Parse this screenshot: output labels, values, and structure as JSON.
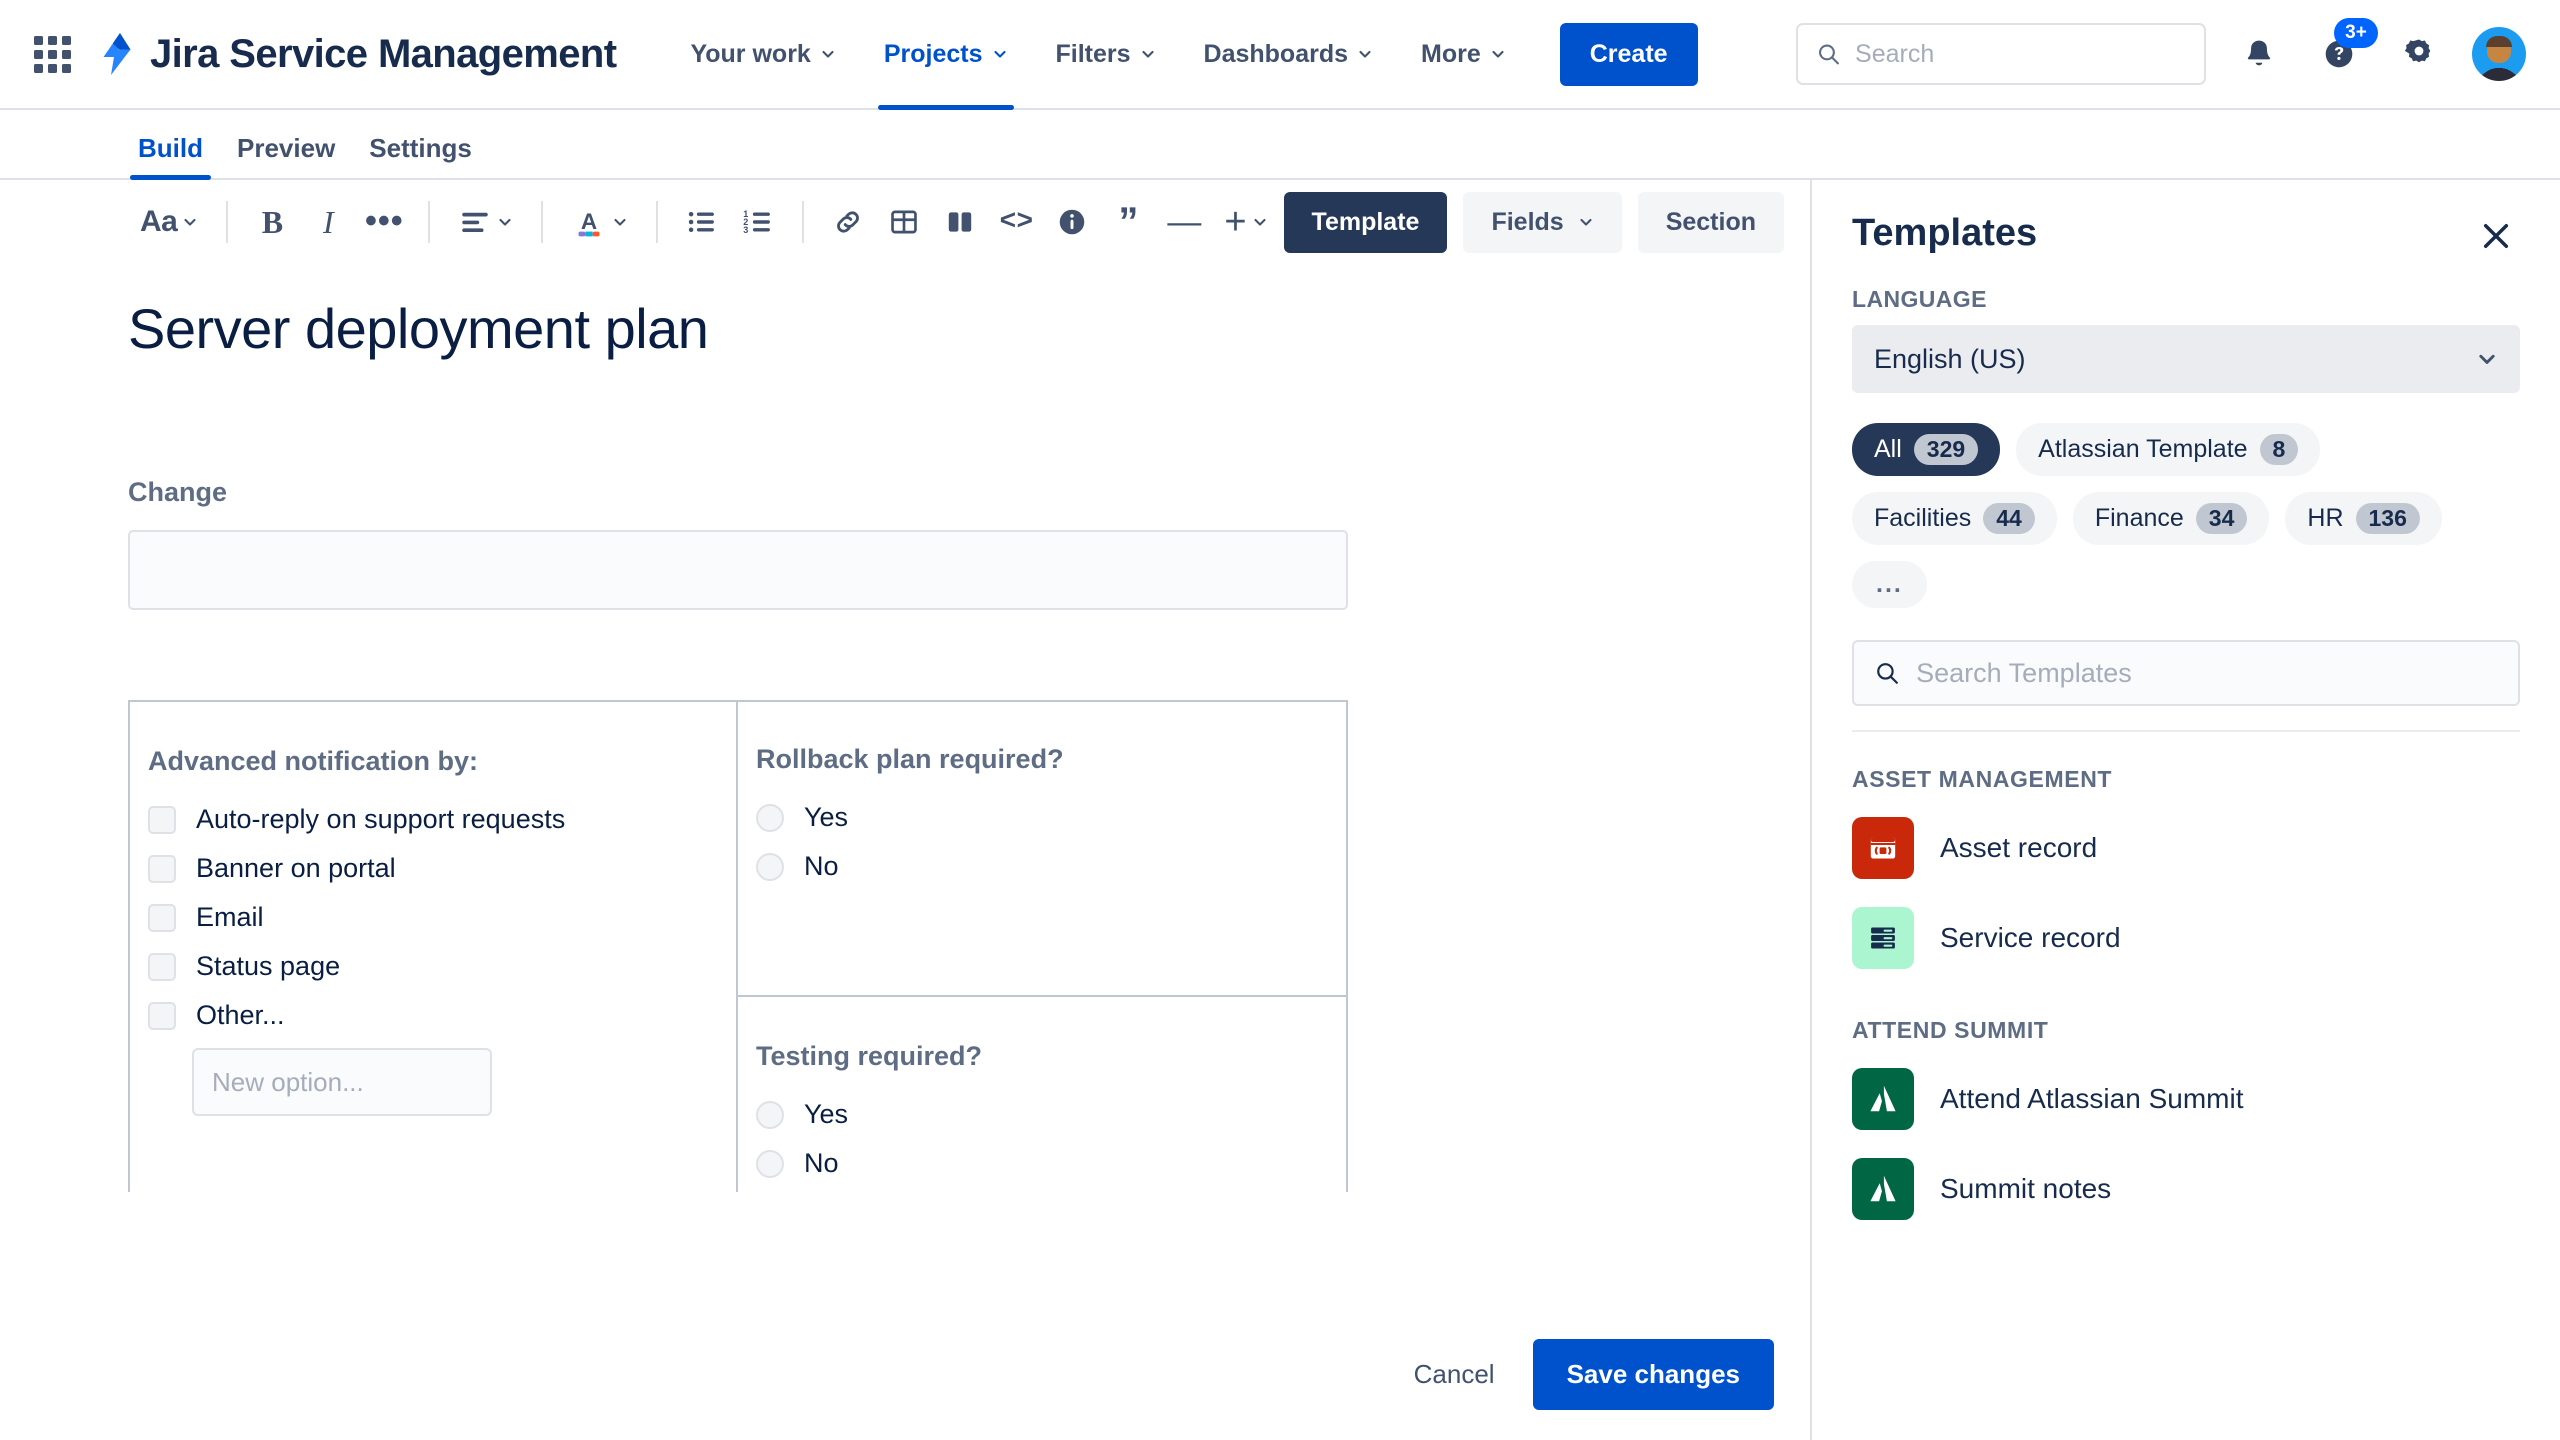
{
  "topnav": {
    "apps_icon": "app-switcher-grid-icon",
    "product_name": "Jira Service Management",
    "logo_icon": "jira-service-management-logo-icon",
    "items": [
      {
        "label": "Your work",
        "has_chevron": true,
        "active": false
      },
      {
        "label": "Projects",
        "has_chevron": true,
        "active": true
      },
      {
        "label": "Filters",
        "has_chevron": true,
        "active": false
      },
      {
        "label": "Dashboards",
        "has_chevron": true,
        "active": false
      },
      {
        "label": "More",
        "has_chevron": true,
        "active": false
      }
    ],
    "create_label": "Create",
    "search_placeholder": "Search",
    "search_value": "",
    "search_icon": "search-icon",
    "notifications_icon": "notification-bell-icon",
    "help_icon": "help-question-icon",
    "help_badge": "3+",
    "settings_icon": "gear-icon",
    "avatar_icon": "user-avatar"
  },
  "subtabs": [
    {
      "label": "Build",
      "active": true
    },
    {
      "label": "Preview",
      "active": false
    },
    {
      "label": "Settings",
      "active": false
    }
  ],
  "toolbar": {
    "text_style_label": "Aa",
    "bold_label": "B",
    "italic_label": "I",
    "more_formatting_label": "•••",
    "align_icon": "text-align-icon",
    "text_color_label": "A",
    "bullet_list_icon": "bullet-list-icon",
    "numbered_list_icon": "numbered-list-icon",
    "link_icon": "link-icon",
    "table_icon": "table-icon",
    "layout_icon": "columns-layout-icon",
    "code_label": "<>",
    "info_panel_icon": "info-panel-icon",
    "quote_label": "”",
    "divider_label": "—",
    "plus_label": "+",
    "segments": [
      {
        "label": "Template",
        "active": true,
        "has_chevron": false
      },
      {
        "label": "Fields",
        "active": false,
        "has_chevron": true
      },
      {
        "label": "Section",
        "active": false,
        "has_chevron": false
      }
    ]
  },
  "document": {
    "title": "Server deployment plan",
    "change_field": {
      "label": "Change",
      "value": "",
      "placeholder": ""
    },
    "left_column": {
      "group_label": "Advanced notification by:",
      "options": [
        {
          "label": "Auto-reply on support requests",
          "checked": false
        },
        {
          "label": "Banner on portal",
          "checked": false
        },
        {
          "label": "Email",
          "checked": false
        },
        {
          "label": "Status page",
          "checked": false
        },
        {
          "label": "Other...",
          "checked": false
        }
      ],
      "new_option_placeholder": "New option...",
      "new_option_value": ""
    },
    "right_column": [
      {
        "group_label": "Rollback plan required?",
        "options": [
          {
            "label": "Yes",
            "selected": false
          },
          {
            "label": "No",
            "selected": false
          }
        ]
      },
      {
        "group_label": "Testing required?",
        "options": [
          {
            "label": "Yes",
            "selected": false
          },
          {
            "label": "No",
            "selected": false
          }
        ]
      }
    ]
  },
  "footer": {
    "cancel_label": "Cancel",
    "save_label": "Save changes"
  },
  "templates_panel": {
    "title": "Templates",
    "close_icon": "close-icon",
    "language_label": "LANGUAGE",
    "language_value": "English (US)",
    "language_chevron_icon": "chevron-down-icon",
    "chips": [
      {
        "label": "All",
        "count": "329",
        "active": true
      },
      {
        "label": "Atlassian Template",
        "count": "8",
        "active": false
      },
      {
        "label": "Facilities",
        "count": "44",
        "active": false
      },
      {
        "label": "Finance",
        "count": "34",
        "active": false
      },
      {
        "label": "HR",
        "count": "136",
        "active": false
      },
      {
        "label": "...",
        "count": "",
        "active": false
      }
    ],
    "search_placeholder": "Search Templates",
    "search_value": "",
    "search_icon": "search-icon",
    "groups": [
      {
        "label": "ASSET MANAGEMENT",
        "items": [
          {
            "name": "Asset record",
            "icon": "asset-record-icon",
            "icon_bg": "#C9280B",
            "icon_fg": "#FFFFFF"
          },
          {
            "name": "Service record",
            "icon": "service-record-icon",
            "icon_bg": "#ABF5D1",
            "icon_fg": "#172B4D"
          }
        ]
      },
      {
        "label": "ATTEND SUMMIT",
        "items": [
          {
            "name": "Attend Atlassian Summit",
            "icon": "atlassian-summit-icon",
            "icon_bg": "#006644",
            "icon_fg": "#FFFFFF"
          },
          {
            "name": "Summit notes",
            "icon": "atlassian-summit-icon",
            "icon_bg": "#006644",
            "icon_fg": "#FFFFFF"
          }
        ]
      }
    ]
  },
  "colors": {
    "brand_blue": "#0052CC",
    "accent_blue": "#0065FF",
    "dark_navy": "#253858",
    "text": "#172B4D",
    "subtle_text": "#5E6C84",
    "border": "#DFE1E6"
  }
}
